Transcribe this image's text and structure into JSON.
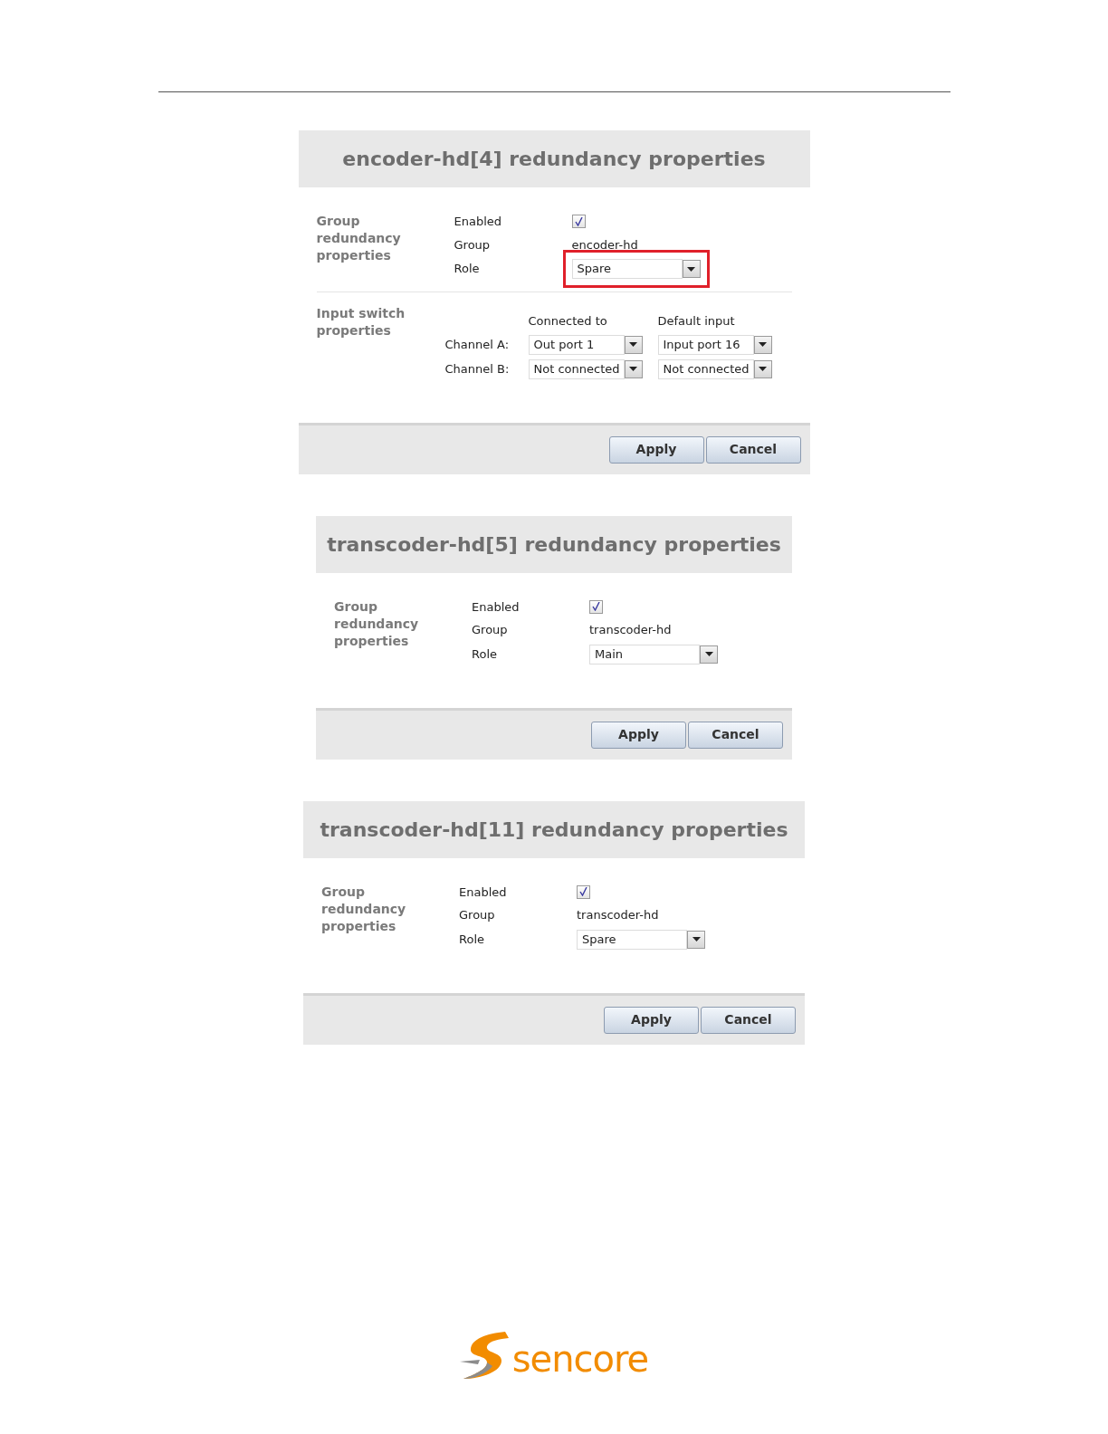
{
  "panels": [
    {
      "title": "encoder-hd[4] redundancy properties",
      "sections": [
        {
          "kind": "group",
          "heading": "Group redundancy properties",
          "enabled": {
            "label": "Enabled",
            "checked": true
          },
          "group": {
            "label": "Group",
            "value": "encoder-hd"
          },
          "role": {
            "label": "Role",
            "value": "Spare",
            "highlighted": true
          }
        },
        {
          "kind": "input_switch",
          "heading": "Input switch properties",
          "columns": [
            "Connected to",
            "Default input"
          ],
          "channels": [
            {
              "label": "Channel A:",
              "connected_to": "Out port 1",
              "default_input": "Input port 16"
            },
            {
              "label": "Channel B:",
              "connected_to": "Not connected",
              "default_input": "Not connected"
            }
          ]
        }
      ],
      "buttons": [
        "Apply",
        "Cancel"
      ]
    },
    {
      "title": "transcoder-hd[5] redundancy properties",
      "sections": [
        {
          "kind": "group",
          "heading": "Group redundancy properties",
          "enabled": {
            "label": "Enabled",
            "checked": true
          },
          "group": {
            "label": "Group",
            "value": "transcoder-hd"
          },
          "role": {
            "label": "Role",
            "value": "Main",
            "highlighted": false
          }
        }
      ],
      "buttons": [
        "Apply",
        "Cancel"
      ]
    },
    {
      "title": "transcoder-hd[11] redundancy properties",
      "sections": [
        {
          "kind": "group",
          "heading": "Group redundancy properties",
          "enabled": {
            "label": "Enabled",
            "checked": true
          },
          "group": {
            "label": "Group",
            "value": "transcoder-hd"
          },
          "role": {
            "label": "Role",
            "value": "Spare",
            "highlighted": false
          }
        }
      ],
      "buttons": [
        "Apply",
        "Cancel"
      ]
    }
  ],
  "footer_logo": {
    "text": "sencore"
  }
}
